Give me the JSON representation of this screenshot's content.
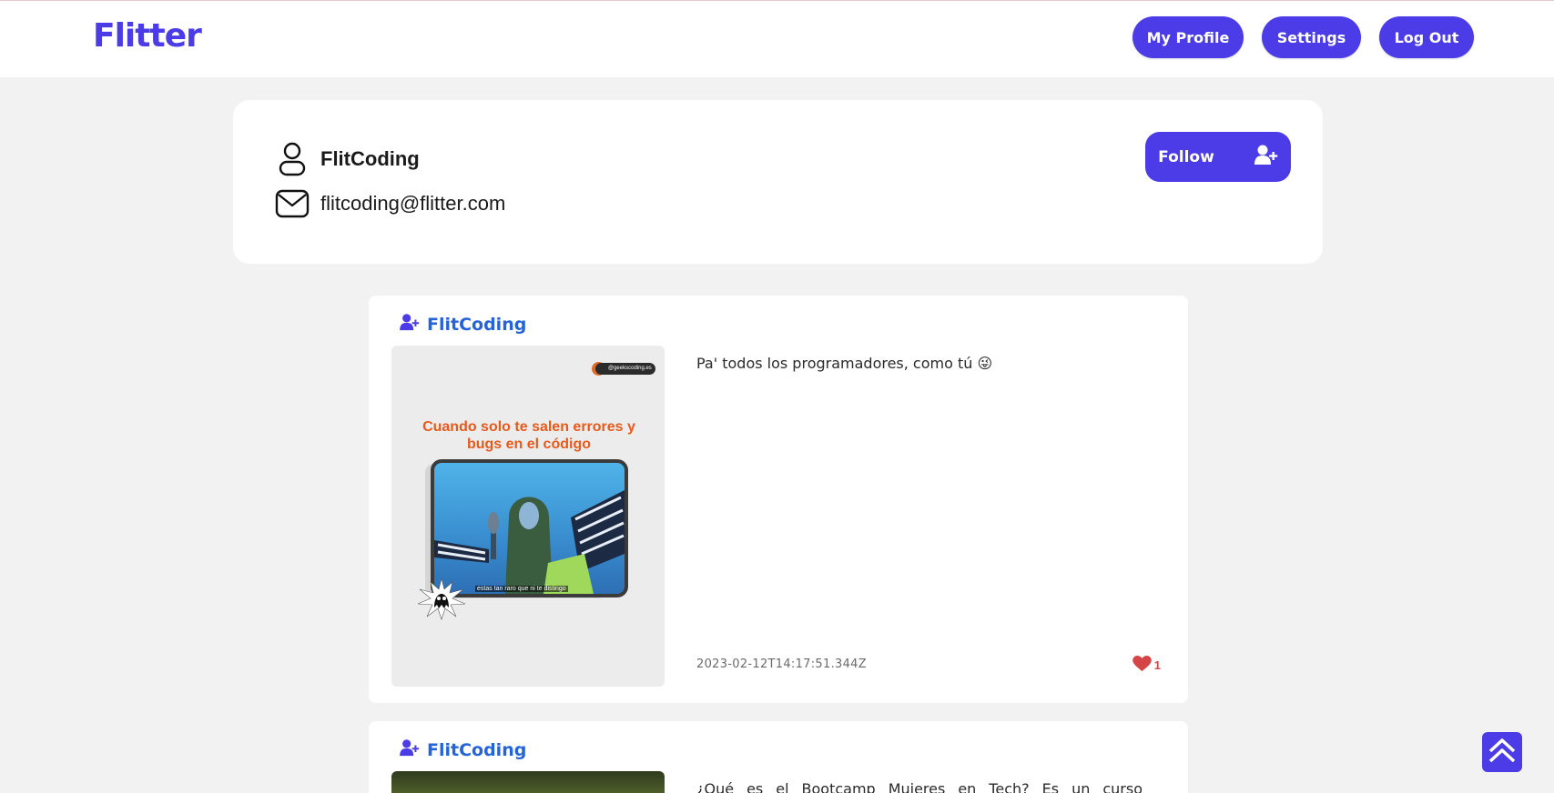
{
  "header": {
    "logo": "Flitter",
    "nav": {
      "my_profile": "My Profile",
      "settings": "Settings",
      "log_out": "Log Out"
    }
  },
  "profile": {
    "username": "FlitCoding",
    "email": "flitcoding@flitter.com",
    "follow_label": "Follow",
    "icons": {
      "user": "user-outline-icon",
      "email": "envelope-icon",
      "follow": "user-plus-icon"
    }
  },
  "posts": [
    {
      "author": "FlitCoding",
      "text": "Pa' todos los programadores, como tú 😜",
      "date": "2023-02-12T14:17:51.344Z",
      "likes": "1",
      "image": {
        "badge": "@geekscoding.es",
        "title": "Cuando solo te salen errores y bugs en el código",
        "subtitle": "estas tan raro que ni te distingo"
      }
    },
    {
      "author": "FlitCoding",
      "text": "¿Qué es el Bootcamp Mujeres en Tech? Es un curso de"
    }
  ],
  "colors": {
    "accent": "#4b3ce8",
    "author_link": "#2563d9",
    "like": "#d64545",
    "background": "#f2f2f2"
  }
}
